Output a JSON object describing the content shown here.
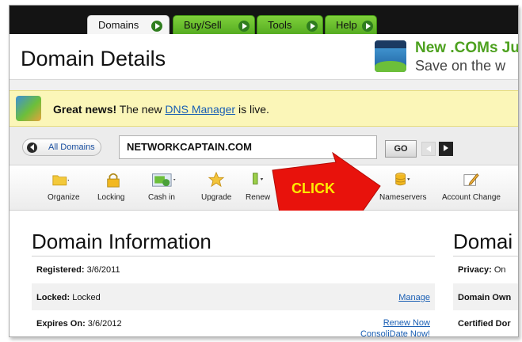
{
  "tabs": [
    {
      "label": "Domains"
    },
    {
      "label": "Buy/Sell"
    },
    {
      "label": "Tools"
    },
    {
      "label": "Help"
    }
  ],
  "header": {
    "title": "Domain Details",
    "promo_line1": "New .COMs Ju",
    "promo_line2": "Save on the w"
  },
  "notice": {
    "bold": "Great news!",
    "pre": " The new ",
    "link": "DNS Manager",
    "post": " is live."
  },
  "search": {
    "all_domains_label": "All Domains",
    "domain_value": "NETWORKCAPTAIN.COM",
    "go_label": "GO"
  },
  "toolbar": {
    "items": [
      {
        "label": "Organize"
      },
      {
        "label": "Locking"
      },
      {
        "label": "Cash in"
      },
      {
        "label": "Upgrade"
      },
      {
        "label": "Renew"
      },
      {
        "label": "Nameservers"
      },
      {
        "label": "Account Change"
      }
    ]
  },
  "callout": {
    "text": "CLICK",
    "color": "#e8120c"
  },
  "domain_info": {
    "title": "Domain Information",
    "title_right": "Domai",
    "rows": [
      {
        "key": "Registered:",
        "value": " 3/6/2011"
      },
      {
        "key": "Locked:",
        "value": " Locked",
        "link": "Manage"
      },
      {
        "key": "Expires On:",
        "value": " 3/6/2012",
        "link1": "Renew Now",
        "link2": "ConsoliDate Now!"
      }
    ],
    "right_rows": [
      {
        "key": "Privacy:",
        "value": " On"
      },
      {
        "key": "Domain Own",
        "value": ""
      },
      {
        "key": "Certified Dor",
        "value": ""
      }
    ]
  },
  "colors": {
    "tab_green": "#52a91f",
    "topbar": "#141414",
    "notice_bg": "#fbf6b8",
    "link": "#1a5fb4",
    "promo_green": "#4da11f"
  }
}
